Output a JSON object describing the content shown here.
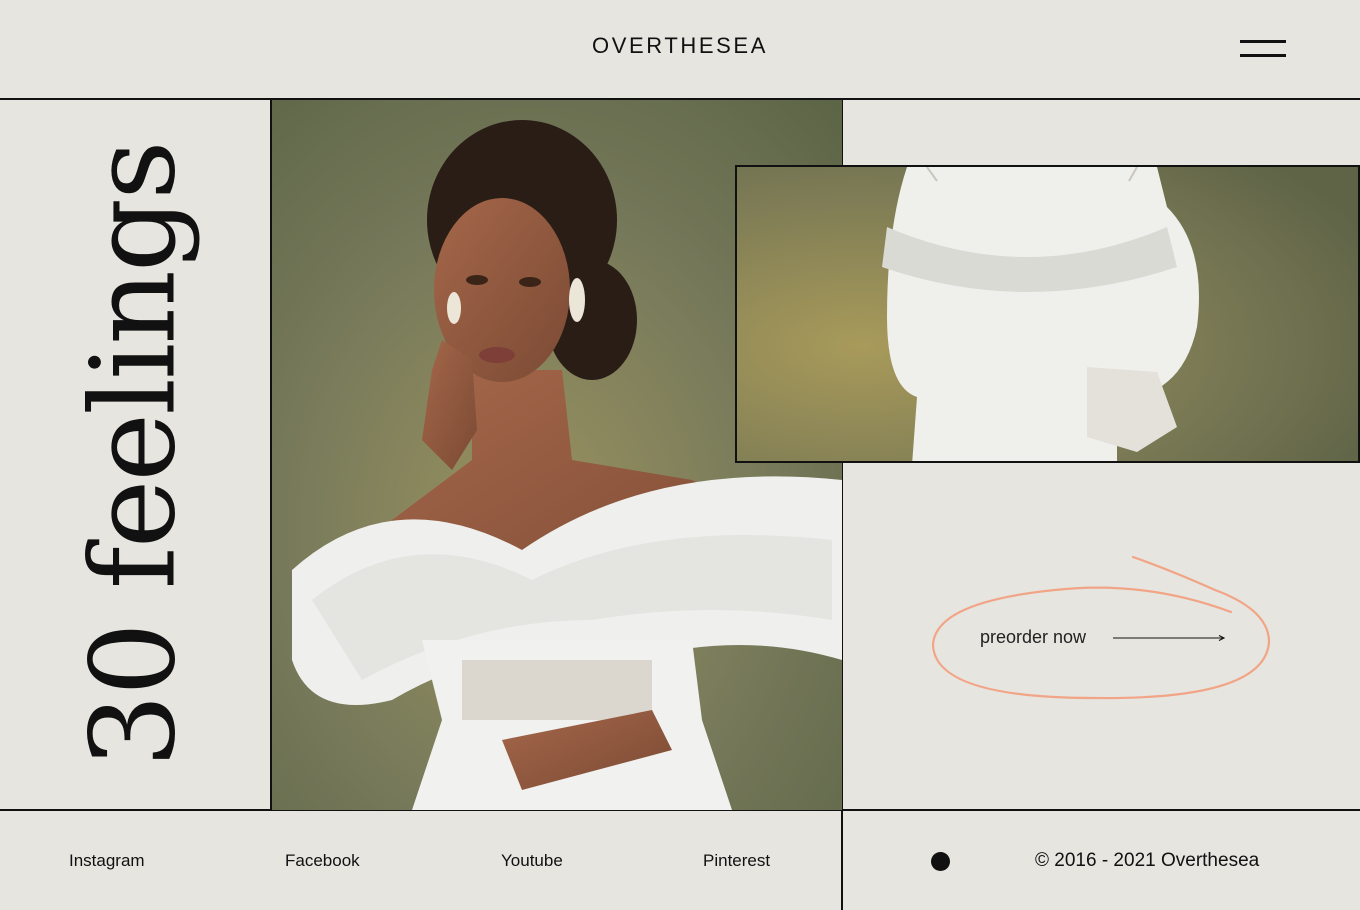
{
  "header": {
    "brand": "OVERTHESEA",
    "menu_icon": "hamburger-menu-icon"
  },
  "hero": {
    "vertical_title": "30 feelings",
    "main_photo_alt": "Model in white off-shoulder ruffled dress",
    "detail_photo_alt": "Close-up of ruffled white dress sleeves"
  },
  "cta": {
    "preorder_label": "preorder now",
    "arrow_icon": "arrow-right-icon",
    "accent_color": "#f2a586"
  },
  "footer": {
    "social_links": [
      "Instagram",
      "Facebook",
      "Youtube",
      "Pinterest"
    ],
    "dot_icon": "circle-dot-icon",
    "copyright": "© 2016 - 2021 Overthesea"
  }
}
